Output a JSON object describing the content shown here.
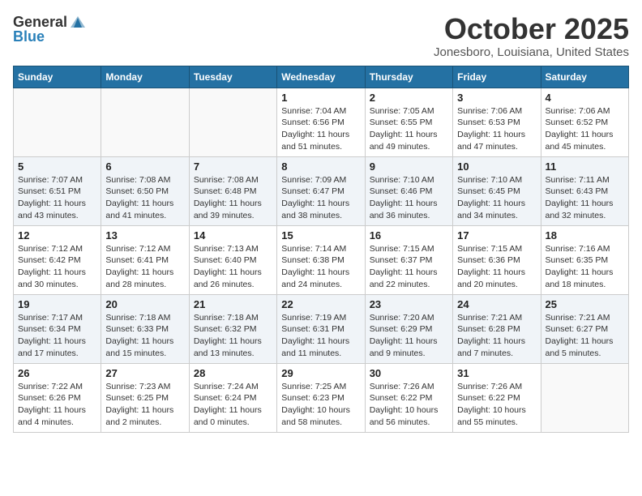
{
  "header": {
    "logo_general": "General",
    "logo_blue": "Blue",
    "month_title": "October 2025",
    "location": "Jonesboro, Louisiana, United States"
  },
  "days_of_week": [
    "Sunday",
    "Monday",
    "Tuesday",
    "Wednesday",
    "Thursday",
    "Friday",
    "Saturday"
  ],
  "weeks": [
    [
      {
        "day": "",
        "info": ""
      },
      {
        "day": "",
        "info": ""
      },
      {
        "day": "",
        "info": ""
      },
      {
        "day": "1",
        "info": "Sunrise: 7:04 AM\nSunset: 6:56 PM\nDaylight: 11 hours\nand 51 minutes."
      },
      {
        "day": "2",
        "info": "Sunrise: 7:05 AM\nSunset: 6:55 PM\nDaylight: 11 hours\nand 49 minutes."
      },
      {
        "day": "3",
        "info": "Sunrise: 7:06 AM\nSunset: 6:53 PM\nDaylight: 11 hours\nand 47 minutes."
      },
      {
        "day": "4",
        "info": "Sunrise: 7:06 AM\nSunset: 6:52 PM\nDaylight: 11 hours\nand 45 minutes."
      }
    ],
    [
      {
        "day": "5",
        "info": "Sunrise: 7:07 AM\nSunset: 6:51 PM\nDaylight: 11 hours\nand 43 minutes."
      },
      {
        "day": "6",
        "info": "Sunrise: 7:08 AM\nSunset: 6:50 PM\nDaylight: 11 hours\nand 41 minutes."
      },
      {
        "day": "7",
        "info": "Sunrise: 7:08 AM\nSunset: 6:48 PM\nDaylight: 11 hours\nand 39 minutes."
      },
      {
        "day": "8",
        "info": "Sunrise: 7:09 AM\nSunset: 6:47 PM\nDaylight: 11 hours\nand 38 minutes."
      },
      {
        "day": "9",
        "info": "Sunrise: 7:10 AM\nSunset: 6:46 PM\nDaylight: 11 hours\nand 36 minutes."
      },
      {
        "day": "10",
        "info": "Sunrise: 7:10 AM\nSunset: 6:45 PM\nDaylight: 11 hours\nand 34 minutes."
      },
      {
        "day": "11",
        "info": "Sunrise: 7:11 AM\nSunset: 6:43 PM\nDaylight: 11 hours\nand 32 minutes."
      }
    ],
    [
      {
        "day": "12",
        "info": "Sunrise: 7:12 AM\nSunset: 6:42 PM\nDaylight: 11 hours\nand 30 minutes."
      },
      {
        "day": "13",
        "info": "Sunrise: 7:12 AM\nSunset: 6:41 PM\nDaylight: 11 hours\nand 28 minutes."
      },
      {
        "day": "14",
        "info": "Sunrise: 7:13 AM\nSunset: 6:40 PM\nDaylight: 11 hours\nand 26 minutes."
      },
      {
        "day": "15",
        "info": "Sunrise: 7:14 AM\nSunset: 6:38 PM\nDaylight: 11 hours\nand 24 minutes."
      },
      {
        "day": "16",
        "info": "Sunrise: 7:15 AM\nSunset: 6:37 PM\nDaylight: 11 hours\nand 22 minutes."
      },
      {
        "day": "17",
        "info": "Sunrise: 7:15 AM\nSunset: 6:36 PM\nDaylight: 11 hours\nand 20 minutes."
      },
      {
        "day": "18",
        "info": "Sunrise: 7:16 AM\nSunset: 6:35 PM\nDaylight: 11 hours\nand 18 minutes."
      }
    ],
    [
      {
        "day": "19",
        "info": "Sunrise: 7:17 AM\nSunset: 6:34 PM\nDaylight: 11 hours\nand 17 minutes."
      },
      {
        "day": "20",
        "info": "Sunrise: 7:18 AM\nSunset: 6:33 PM\nDaylight: 11 hours\nand 15 minutes."
      },
      {
        "day": "21",
        "info": "Sunrise: 7:18 AM\nSunset: 6:32 PM\nDaylight: 11 hours\nand 13 minutes."
      },
      {
        "day": "22",
        "info": "Sunrise: 7:19 AM\nSunset: 6:31 PM\nDaylight: 11 hours\nand 11 minutes."
      },
      {
        "day": "23",
        "info": "Sunrise: 7:20 AM\nSunset: 6:29 PM\nDaylight: 11 hours\nand 9 minutes."
      },
      {
        "day": "24",
        "info": "Sunrise: 7:21 AM\nSunset: 6:28 PM\nDaylight: 11 hours\nand 7 minutes."
      },
      {
        "day": "25",
        "info": "Sunrise: 7:21 AM\nSunset: 6:27 PM\nDaylight: 11 hours\nand 5 minutes."
      }
    ],
    [
      {
        "day": "26",
        "info": "Sunrise: 7:22 AM\nSunset: 6:26 PM\nDaylight: 11 hours\nand 4 minutes."
      },
      {
        "day": "27",
        "info": "Sunrise: 7:23 AM\nSunset: 6:25 PM\nDaylight: 11 hours\nand 2 minutes."
      },
      {
        "day": "28",
        "info": "Sunrise: 7:24 AM\nSunset: 6:24 PM\nDaylight: 11 hours\nand 0 minutes."
      },
      {
        "day": "29",
        "info": "Sunrise: 7:25 AM\nSunset: 6:23 PM\nDaylight: 10 hours\nand 58 minutes."
      },
      {
        "day": "30",
        "info": "Sunrise: 7:26 AM\nSunset: 6:22 PM\nDaylight: 10 hours\nand 56 minutes."
      },
      {
        "day": "31",
        "info": "Sunrise: 7:26 AM\nSunset: 6:22 PM\nDaylight: 10 hours\nand 55 minutes."
      },
      {
        "day": "",
        "info": ""
      }
    ]
  ]
}
